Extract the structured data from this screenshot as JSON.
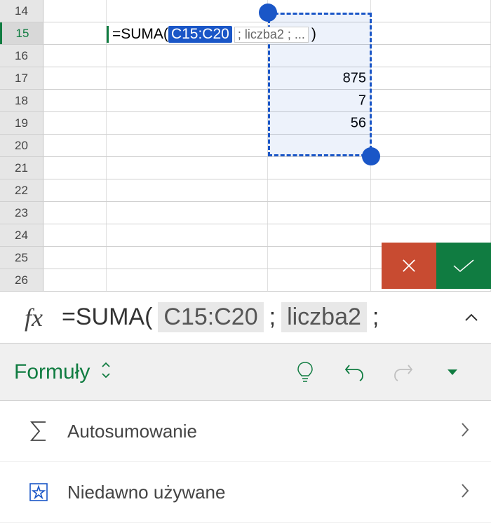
{
  "grid": {
    "visible_rows": [
      14,
      15,
      16,
      17,
      18,
      19,
      20,
      21,
      22,
      23,
      24,
      25,
      26
    ],
    "active_row": 15,
    "values": {
      "17": {
        "C": "875"
      },
      "18": {
        "C": "7"
      },
      "19": {
        "C": "56"
      }
    }
  },
  "inline_formula": {
    "prefix": "=SUMA(",
    "selected_range": "C15:C20",
    "hint": "; liczba2 ; ...",
    "suffix": ")"
  },
  "selection": {
    "range": "C15:C20"
  },
  "formula_bar": {
    "fx": "fx",
    "prefix": "=SUMA(",
    "arg1": "C15:C20",
    "sep": ";",
    "arg2": "liczba2",
    "suffix": ";"
  },
  "toolbar": {
    "label": "Formuły"
  },
  "menu": {
    "items": [
      {
        "label": "Autosumowanie",
        "icon": "sigma"
      },
      {
        "label": "Niedawno używane",
        "icon": "star"
      }
    ]
  },
  "colors": {
    "accent_green": "#107c41",
    "accent_blue": "#1a56c7",
    "cancel": "#c84b31"
  }
}
